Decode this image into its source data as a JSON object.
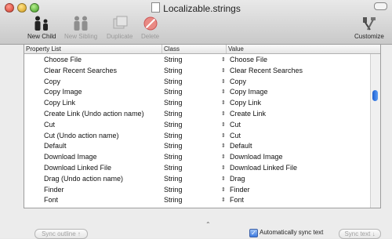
{
  "window": {
    "title": "Localizable.strings"
  },
  "toolbar": {
    "new_child": "New Child",
    "new_sibling": "New Sibling",
    "duplicate": "Duplicate",
    "delete": "Delete",
    "customize": "Customize"
  },
  "table": {
    "headers": [
      "Property List",
      "Class",
      "Value"
    ],
    "rows": [
      {
        "key": "Choose File",
        "class": "String",
        "value": "Choose File"
      },
      {
        "key": "Clear Recent Searches",
        "class": "String",
        "value": "Clear Recent Searches"
      },
      {
        "key": "Copy",
        "class": "String",
        "value": "Copy"
      },
      {
        "key": "Copy Image",
        "class": "String",
        "value": "Copy Image"
      },
      {
        "key": "Copy Link",
        "class": "String",
        "value": "Copy Link"
      },
      {
        "key": "Create Link (Undo action name)",
        "class": "String",
        "value": "Create Link"
      },
      {
        "key": "Cut",
        "class": "String",
        "value": "Cut"
      },
      {
        "key": "Cut (Undo action name)",
        "class": "String",
        "value": "Cut"
      },
      {
        "key": "Default",
        "class": "String",
        "value": "Default"
      },
      {
        "key": "Download Image",
        "class": "String",
        "value": "Download Image"
      },
      {
        "key": "Download Linked File",
        "class": "String",
        "value": "Download Linked File"
      },
      {
        "key": "Drag (Undo action name)",
        "class": "String",
        "value": "Drag"
      },
      {
        "key": "Finder",
        "class": "String",
        "value": "Finder"
      },
      {
        "key": "Font",
        "class": "String",
        "value": "Font"
      }
    ]
  },
  "bottom": {
    "sync_outline": "Sync outline ↑",
    "auto_sync_label": "Automatically sync text",
    "auto_sync_checked": true,
    "sync_text": "Sync text ↓"
  },
  "colors": {
    "accent": "#3b7ae0",
    "delete_red": "#e0443a"
  }
}
